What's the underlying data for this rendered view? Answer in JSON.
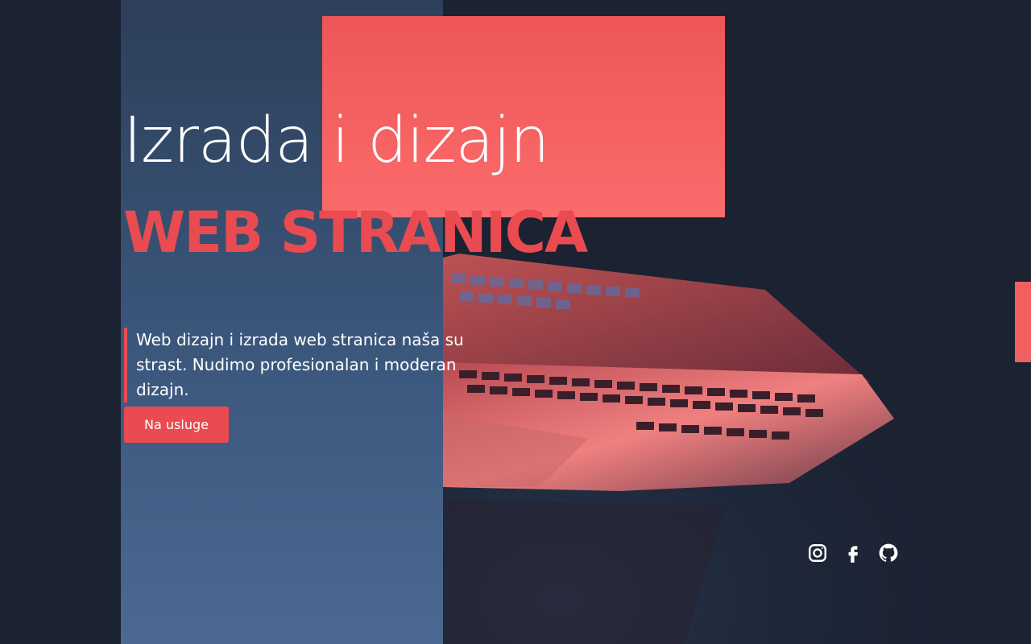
{
  "hero": {
    "title_light": "Izrada i dizajn",
    "title_bold": "WEB STRANICA",
    "description": "Web dizajn i izrada web stranica naša su strast. Nudimo profesionalan i moderan dizajn.",
    "cta_label": "Na usluge"
  },
  "social": [
    {
      "icon": "instagram-icon"
    },
    {
      "icon": "facebook-icon"
    },
    {
      "icon": "github-icon"
    }
  ],
  "colors": {
    "background": "#1b2232",
    "panel_top": "#2d3f59",
    "panel_bottom": "#4b6992",
    "accent": "#e94b50",
    "accent_light": "#fb6b6b",
    "text": "#ffffff"
  }
}
